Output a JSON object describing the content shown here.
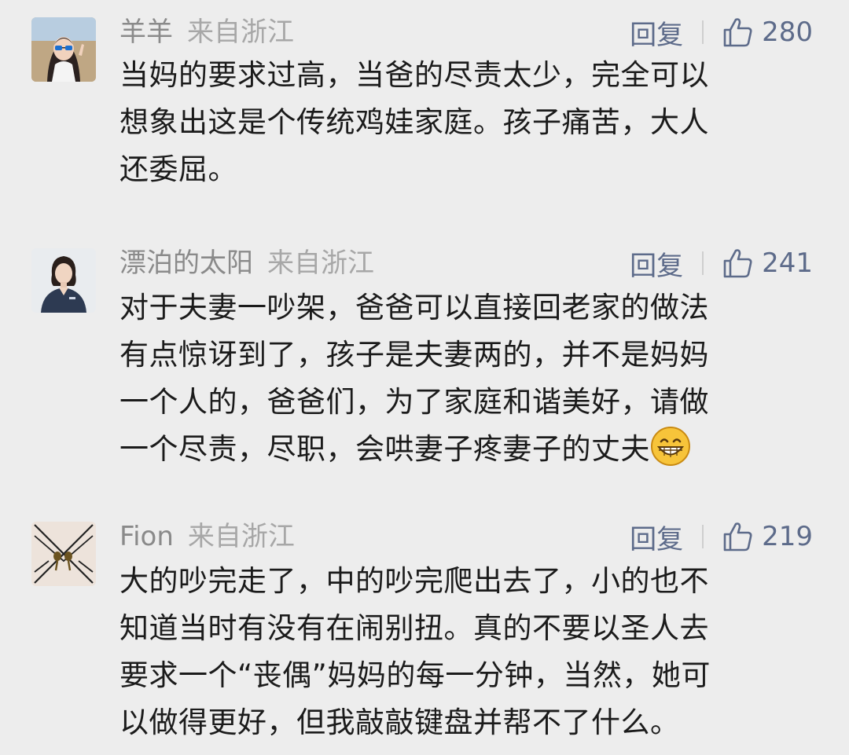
{
  "comments": [
    {
      "username": "羊羊",
      "location": "来自浙江",
      "reply_label": "回复",
      "likes": "280",
      "lines": [
        "当妈的要求过高，当爸的尽责太少，完全可以",
        "想象出这是个传统鸡娃家庭。孩子痛苦，大人",
        "还委屈。"
      ],
      "avatar_icon": "avatar-woman-sunglasses"
    },
    {
      "username": "漂泊的太阳",
      "location": "来自浙江",
      "reply_label": "回复",
      "likes": "241",
      "lines": [
        "对于夫妻一吵架，爸爸可以直接回老家的做法",
        "有点惊讶到了，孩子是夫妻两的，并不是妈妈",
        "一个人的，爸爸们，为了家庭和谐美好，请做",
        "一个尽责，尽职，会哄妻子疼妻子的丈夫"
      ],
      "emoji": "grinning-face-emoji",
      "avatar_icon": "avatar-woman-scrubs"
    },
    {
      "username": "Fion",
      "location": "来自浙江",
      "reply_label": "回复",
      "likes": "219",
      "lines": [
        "大的吵完走了，中的吵完爬出去了，小的也不",
        "知道当时有没有在闹别扭。真的不要以圣人去",
        "要求一个“丧偶”妈妈的每一分钟，当然，她可",
        "以做得更好，但我敲敲键盘并帮不了什么。"
      ],
      "avatar_icon": "avatar-lines-pattern"
    }
  ],
  "colors": {
    "background": "#ededed",
    "username": "#8a8a8a",
    "location": "#a7a7a7",
    "action": "#5d6b8a",
    "text": "#1b1b1b"
  }
}
